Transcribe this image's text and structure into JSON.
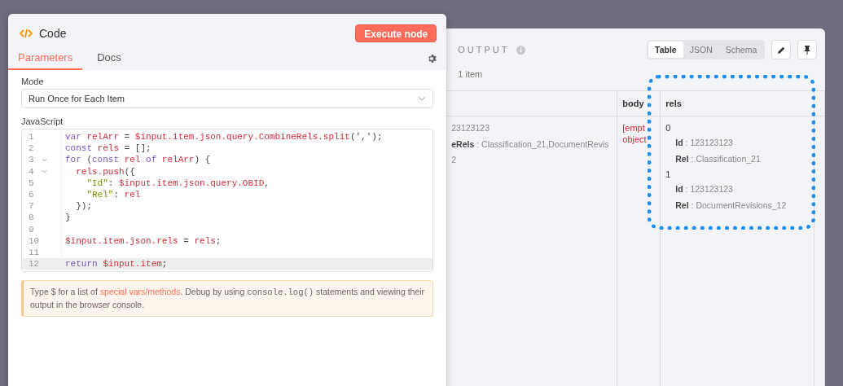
{
  "node_panel": {
    "title": "Code",
    "execute_button": "Execute node",
    "tabs": [
      {
        "label": "Parameters",
        "selected": true
      },
      {
        "label": "Docs",
        "selected": false
      }
    ],
    "mode": {
      "label": "Mode",
      "value": "Run Once for Each Item"
    },
    "editor": {
      "label": "JavaScript",
      "lines": [
        {
          "number": "1",
          "fold": false,
          "active": false,
          "tokens": [
            {
              "kind": "keyword",
              "text": "var "
            },
            {
              "kind": "variable",
              "text": "relArr"
            },
            {
              "kind": "punct",
              "text": " = "
            },
            {
              "kind": "variable",
              "text": "$input.item.json.query.CombineRels.split"
            },
            {
              "kind": "punct",
              "text": "(','"
            },
            {
              "kind": "punct",
              "text": ");"
            }
          ]
        },
        {
          "number": "2",
          "fold": false,
          "active": false,
          "tokens": [
            {
              "kind": "keyword",
              "text": "const "
            },
            {
              "kind": "variable",
              "text": "rels"
            },
            {
              "kind": "punct",
              "text": " = [];"
            }
          ]
        },
        {
          "number": "3",
          "fold": true,
          "active": false,
          "tokens": [
            {
              "kind": "keyword",
              "text": "for "
            },
            {
              "kind": "punct",
              "text": "("
            },
            {
              "kind": "keyword",
              "text": "const "
            },
            {
              "kind": "variable",
              "text": "rel"
            },
            {
              "kind": "keyword",
              "text": " of "
            },
            {
              "kind": "variable",
              "text": "relArr"
            },
            {
              "kind": "punct",
              "text": ") {"
            }
          ]
        },
        {
          "number": "4",
          "fold": true,
          "active": false,
          "tokens": [
            {
              "kind": "variable",
              "text": "  rels.push"
            },
            {
              "kind": "punct",
              "text": "({"
            }
          ]
        },
        {
          "number": "5",
          "fold": false,
          "active": false,
          "tokens": [
            {
              "kind": "string",
              "text": "    \"Id\""
            },
            {
              "kind": "punct",
              "text": ": "
            },
            {
              "kind": "variable",
              "text": "$input.item.json.query.OBID"
            },
            {
              "kind": "punct",
              "text": ","
            }
          ]
        },
        {
          "number": "6",
          "fold": false,
          "active": false,
          "tokens": [
            {
              "kind": "string",
              "text": "    \"Rel\""
            },
            {
              "kind": "punct",
              "text": ": "
            },
            {
              "kind": "variable",
              "text": "rel"
            }
          ]
        },
        {
          "number": "7",
          "fold": false,
          "active": false,
          "tokens": [
            {
              "kind": "punct",
              "text": "  });"
            }
          ]
        },
        {
          "number": "8",
          "fold": false,
          "active": false,
          "tokens": [
            {
              "kind": "punct",
              "text": "}"
            }
          ]
        },
        {
          "number": "9",
          "fold": false,
          "active": false
        },
        {
          "number": "10",
          "fold": false,
          "active": false,
          "tokens": [
            {
              "kind": "variable",
              "text": "$input.item.json.rels"
            },
            {
              "kind": "punct",
              "text": " = "
            },
            {
              "kind": "variable",
              "text": "rels"
            },
            {
              "kind": "punct",
              "text": ";"
            }
          ]
        },
        {
          "number": "11",
          "fold": false,
          "active": false
        },
        {
          "number": "12",
          "fold": false,
          "active": true,
          "tokens": [
            {
              "kind": "keyword",
              "text": "return "
            },
            {
              "kind": "variable",
              "text": "$input.item"
            },
            {
              "kind": "punct",
              "text": ";"
            }
          ]
        }
      ]
    },
    "hint": {
      "before": "Type $ for a list of ",
      "link": "special vars/methods",
      "middle": ". Debug by using ",
      "code": "console.log()",
      "after": " statements and viewing their output in the browser console."
    }
  },
  "output_panel": {
    "title": "OUTPUT",
    "count": "1 item",
    "views": [
      {
        "label": "Table",
        "selected": true
      },
      {
        "label": "JSON",
        "selected": false
      },
      {
        "label": "Schema",
        "selected": false
      }
    ],
    "table": {
      "columns": [
        "body",
        "rels"
      ],
      "row": {
        "column_1": [
          {
            "value": "23123123"
          },
          {
            "key": "eRels",
            "separator": ":",
            "value": "Classification_21,DocumentRevis"
          },
          {
            "value": "2"
          }
        ],
        "body": [
          "[empt",
          "object"
        ],
        "rels": [
          {
            "index": "0",
            "fields": [
              {
                "key": "Id",
                "separator": ":",
                "value": "123123123"
              },
              {
                "key": "Rel",
                "separator": ":",
                "value": "Classification_21"
              }
            ]
          },
          {
            "index": "1",
            "fields": [
              {
                "key": "Id",
                "separator": ":",
                "value": "123123123"
              },
              {
                "key": "Rel",
                "separator": ":",
                "value": "DocumentRevisions_12"
              }
            ]
          }
        ]
      }
    }
  }
}
